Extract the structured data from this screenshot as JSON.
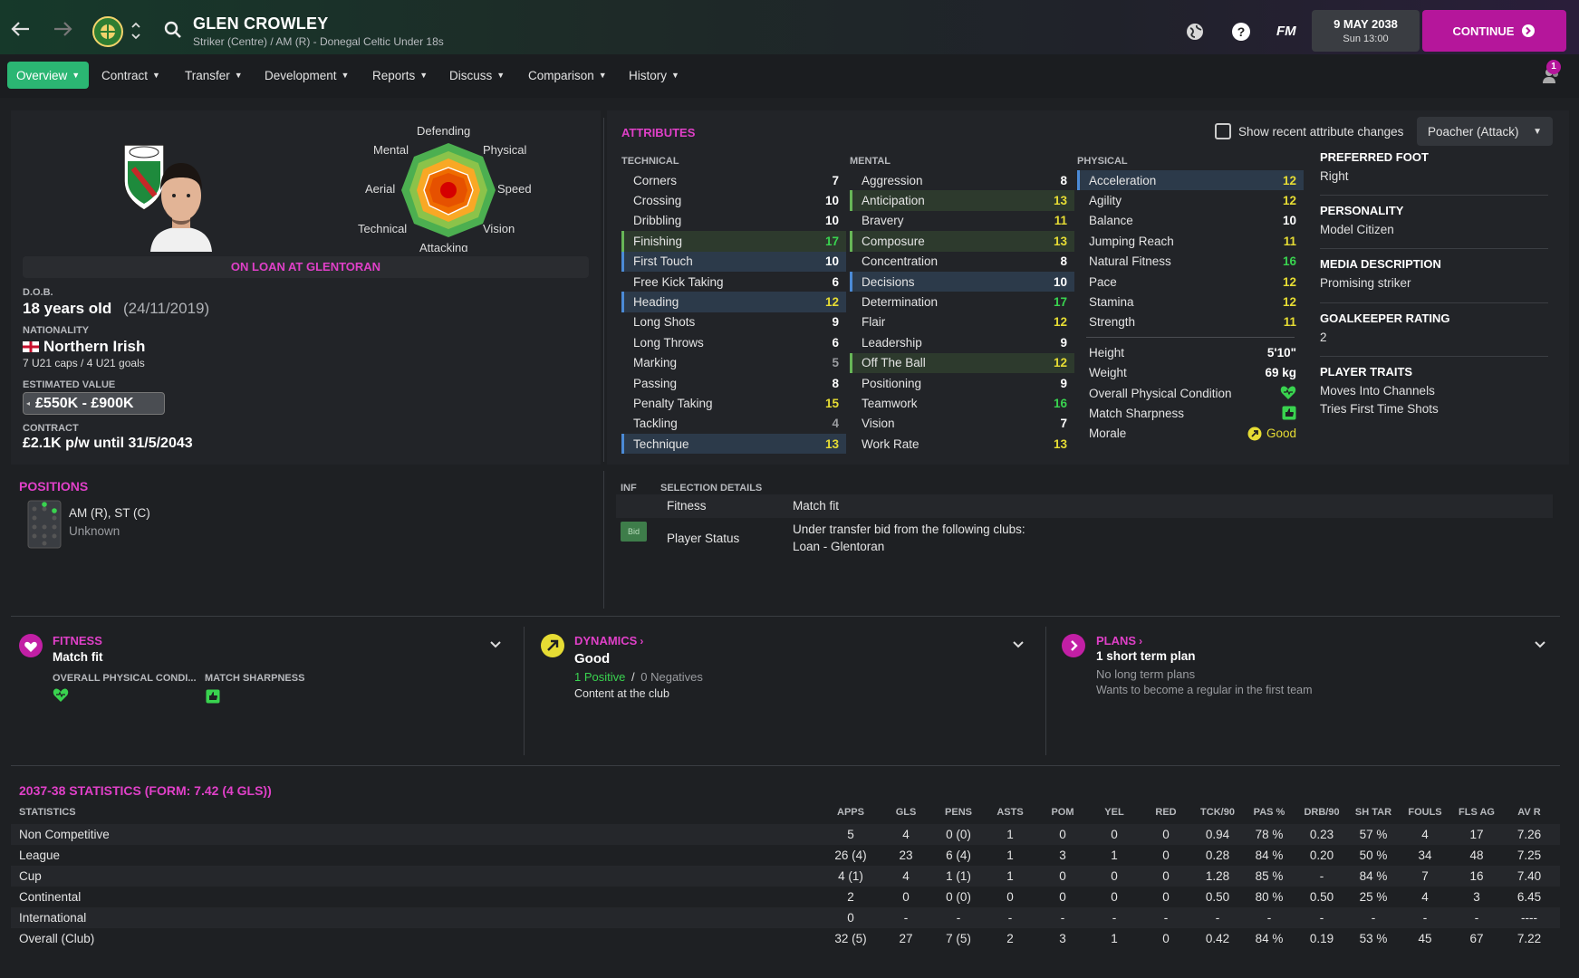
{
  "header": {
    "player_name": "GLEN CROWLEY",
    "subtitle": "Striker (Centre) / AM (R) - Donegal Celtic Under 18s",
    "date": "9 MAY 2038",
    "time": "Sun 13:00",
    "continue_label": "CONTINUE",
    "fm_label": "FM",
    "notification_count": "1"
  },
  "tabs": [
    {
      "label": "Overview"
    },
    {
      "label": "Contract"
    },
    {
      "label": "Transfer"
    },
    {
      "label": "Development"
    },
    {
      "label": "Reports"
    },
    {
      "label": "Discuss"
    },
    {
      "label": "Comparison"
    },
    {
      "label": "History"
    }
  ],
  "profile": {
    "radar_labels": {
      "defending": "Defending",
      "physical": "Physical",
      "speed": "Speed",
      "vision": "Vision",
      "attacking": "Attacking",
      "technical": "Technical",
      "aerial": "Aerial",
      "mental": "Mental"
    },
    "loan_banner": "ON LOAN AT GLENTORAN",
    "dob_label": "D.O.B.",
    "age": "18 years old",
    "dob": "(24/11/2019)",
    "nationality_label": "NATIONALITY",
    "nationality": "Northern Irish",
    "caps": "7 U21 caps / 4 U21 goals",
    "value_label": "ESTIMATED VALUE",
    "value": "£550K - £900K",
    "contract_label": "CONTRACT",
    "contract": "£2.1K p/w until 31/5/2043"
  },
  "attributes": {
    "title": "ATTRIBUTES",
    "show_changes_label": "Show recent attribute changes",
    "role": "Poacher (Attack)",
    "technical_header": "TECHNICAL",
    "mental_header": "MENTAL",
    "physical_header": "PHYSICAL",
    "technical": [
      {
        "name": "Corners",
        "value": "7"
      },
      {
        "name": "Crossing",
        "value": "10"
      },
      {
        "name": "Dribbling",
        "value": "10"
      },
      {
        "name": "Finishing",
        "value": "17"
      },
      {
        "name": "First Touch",
        "value": "10"
      },
      {
        "name": "Free Kick Taking",
        "value": "6"
      },
      {
        "name": "Heading",
        "value": "12"
      },
      {
        "name": "Long Shots",
        "value": "9"
      },
      {
        "name": "Long Throws",
        "value": "6"
      },
      {
        "name": "Marking",
        "value": "5"
      },
      {
        "name": "Passing",
        "value": "8"
      },
      {
        "name": "Penalty Taking",
        "value": "15"
      },
      {
        "name": "Tackling",
        "value": "4"
      },
      {
        "name": "Technique",
        "value": "13"
      }
    ],
    "mental": [
      {
        "name": "Aggression",
        "value": "8"
      },
      {
        "name": "Anticipation",
        "value": "13"
      },
      {
        "name": "Bravery",
        "value": "11"
      },
      {
        "name": "Composure",
        "value": "13"
      },
      {
        "name": "Concentration",
        "value": "8"
      },
      {
        "name": "Decisions",
        "value": "10"
      },
      {
        "name": "Determination",
        "value": "17"
      },
      {
        "name": "Flair",
        "value": "12"
      },
      {
        "name": "Leadership",
        "value": "9"
      },
      {
        "name": "Off The Ball",
        "value": "12"
      },
      {
        "name": "Positioning",
        "value": "9"
      },
      {
        "name": "Teamwork",
        "value": "16"
      },
      {
        "name": "Vision",
        "value": "7"
      },
      {
        "name": "Work Rate",
        "value": "13"
      }
    ],
    "physical": [
      {
        "name": "Acceleration",
        "value": "12"
      },
      {
        "name": "Agility",
        "value": "12"
      },
      {
        "name": "Balance",
        "value": "10"
      },
      {
        "name": "Jumping Reach",
        "value": "11"
      },
      {
        "name": "Natural Fitness",
        "value": "16"
      },
      {
        "name": "Pace",
        "value": "12"
      },
      {
        "name": "Stamina",
        "value": "12"
      },
      {
        "name": "Strength",
        "value": "11"
      }
    ],
    "extra": {
      "height_label": "Height",
      "height": "5'10\"",
      "weight_label": "Weight",
      "weight": "69 kg",
      "condition_label": "Overall Physical Condition",
      "sharpness_label": "Match Sharpness",
      "morale_label": "Morale",
      "morale": "Good"
    }
  },
  "info": {
    "foot_label": "PREFERRED FOOT",
    "foot": "Right",
    "personality_label": "PERSONALITY",
    "personality": "Model Citizen",
    "media_label": "MEDIA DESCRIPTION",
    "media": "Promising striker",
    "gk_label": "GOALKEEPER RATING",
    "gk": "2",
    "traits_label": "PLAYER TRAITS",
    "traits": [
      "Moves Into Channels",
      "Tries First Time Shots"
    ]
  },
  "positions": {
    "title": "POSITIONS",
    "positions": "AM (R), ST (C)",
    "sub": "Unknown"
  },
  "selection": {
    "inf_header": "INF",
    "details_header": "SELECTION DETAILS",
    "fitness_label": "Fitness",
    "fitness_value": "Match fit",
    "status_badge": "Bid",
    "status_label": "Player Status",
    "status_line1": "Under transfer bid from the following clubs:",
    "status_line2": "Loan - Glentoran"
  },
  "cards": {
    "fitness_title": "FITNESS",
    "fitness_value": "Match fit",
    "opc_label": "OVERALL PHYSICAL CONDI...",
    "ms_label": "MATCH SHARPNESS",
    "dynamics_title": "DYNAMICS",
    "dynamics_value": "Good",
    "positives": "1 Positive",
    "slash": "/",
    "negatives": "0 Negatives",
    "dynamics_sub": "Content at the club",
    "plans_title": "PLANS",
    "plans_value": "1 short term plan",
    "plans_line1": "No long term plans",
    "plans_line2": "Wants to become a regular in the first team"
  },
  "stats": {
    "title": "2037-38 STATISTICS (FORM: 7.42 (4 GLS))",
    "columns": [
      "STATISTICS",
      "APPS",
      "GLS",
      "PENS",
      "ASTS",
      "POM",
      "YEL",
      "RED",
      "TCK/90",
      "PAS %",
      "DRB/90",
      "SH TAR",
      "FOULS",
      "FLS AG",
      "AV R"
    ],
    "rows": [
      [
        "Non Competitive",
        "5",
        "4",
        "0 (0)",
        "1",
        "0",
        "0",
        "0",
        "0.94",
        "78 %",
        "0.23",
        "57 %",
        "4",
        "17",
        "7.26"
      ],
      [
        "League",
        "26 (4)",
        "23",
        "6 (4)",
        "1",
        "3",
        "1",
        "0",
        "0.28",
        "84 %",
        "0.20",
        "50 %",
        "34",
        "48",
        "7.25"
      ],
      [
        "Cup",
        "4 (1)",
        "4",
        "1 (1)",
        "1",
        "0",
        "0",
        "0",
        "1.28",
        "85 %",
        "-",
        "84 %",
        "7",
        "16",
        "7.40"
      ],
      [
        "Continental",
        "2",
        "0",
        "0 (0)",
        "0",
        "0",
        "0",
        "0",
        "0.50",
        "80 %",
        "0.50",
        "25 %",
        "4",
        "3",
        "6.45"
      ],
      [
        "International",
        "0",
        "-",
        "-",
        "-",
        "-",
        "-",
        "-",
        "-",
        "-",
        "-",
        "-",
        "-",
        "-",
        "----"
      ],
      [
        "Overall (Club)",
        "32 (5)",
        "27",
        "7 (5)",
        "2",
        "3",
        "1",
        "0",
        "0.42",
        "84 %",
        "0.19",
        "53 %",
        "45",
        "67",
        "7.22"
      ]
    ]
  }
}
